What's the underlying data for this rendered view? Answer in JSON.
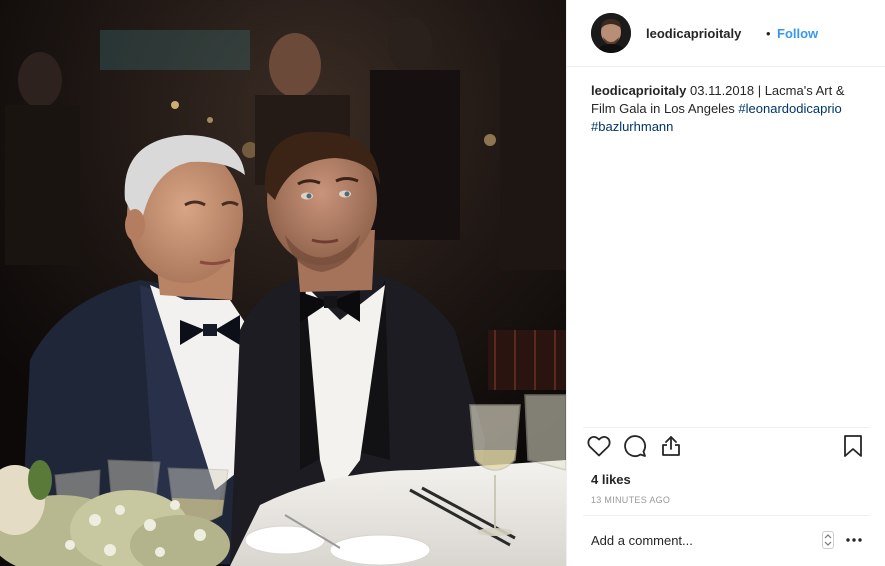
{
  "header": {
    "username": "leodicaprioitaly",
    "separator": "•",
    "follow_label": "Follow"
  },
  "caption": {
    "username": "leodicaprioitaly",
    "text": "03.11.2018 | Lacma's Art & Film Gala in Los Angeles",
    "hashtags": [
      "#leonardodicaprio",
      "#bazlurhmann"
    ]
  },
  "actions": {
    "like_icon": "heart-icon",
    "comment_icon": "comment-icon",
    "share_icon": "share-icon",
    "save_icon": "bookmark-icon"
  },
  "likes_label": "4 likes",
  "time_ago": "13 MINUTES AGO",
  "comment": {
    "placeholder": "Add a comment...",
    "more_icon": "more-options-icon"
  },
  "colors": {
    "link_blue": "#3897f0",
    "hashtag": "#003569",
    "text": "#262626",
    "muted": "#999999",
    "divider": "#efefef"
  }
}
